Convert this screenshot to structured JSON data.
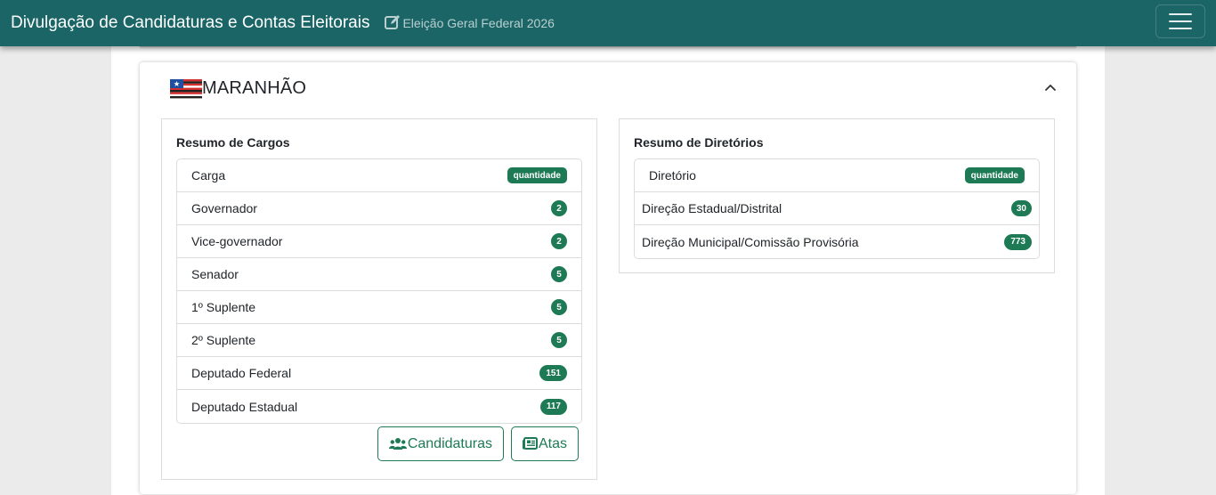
{
  "navbar": {
    "title": "Divulgação de Candidaturas e Contas Eleitorais",
    "election_label": "Eleição Geral Federal 2026",
    "election_icon": "edit-icon",
    "menu_icon": "hamburger-menu-icon"
  },
  "state": {
    "name": "MARANHÃO",
    "flag_icon": "maranhao-flag",
    "collapse_icon": "chevron-up-icon"
  },
  "cargos": {
    "title": "Resumo de Cargos",
    "header": {
      "label": "Carga",
      "badge": "quantidade"
    },
    "rows": [
      {
        "label": "Governador",
        "count": "2"
      },
      {
        "label": "Vice-governador",
        "count": "2"
      },
      {
        "label": "Senador",
        "count": "5"
      },
      {
        "label": "1º Suplente",
        "count": "5"
      },
      {
        "label": "2º Suplente",
        "count": "5"
      },
      {
        "label": "Deputado Federal",
        "count": "151"
      },
      {
        "label": "Deputado Estadual",
        "count": "117"
      }
    ],
    "buttons": {
      "candidaturas": "Candidaturas",
      "atas": "Atas"
    }
  },
  "diretorios": {
    "title": "Resumo de Diretórios",
    "header": {
      "label": "Diretório",
      "badge": "quantidade"
    },
    "rows": [
      {
        "label": "Direção Estadual/Distrital",
        "count": "30"
      },
      {
        "label": "Direção Municipal/Comissão Provisória",
        "count": "773"
      }
    ]
  },
  "colors": {
    "navbar": "#1b6567",
    "accent_green": "#1d7a55",
    "page_bg": "#ebebeb"
  }
}
